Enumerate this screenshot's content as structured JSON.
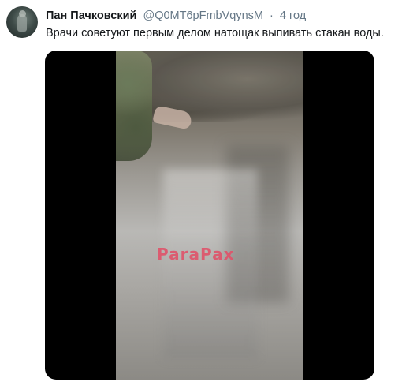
{
  "tweet": {
    "author_name": "Пан Пачковский",
    "author_handle": "@Q0MT6pFmbVqynsM",
    "separator": "·",
    "timestamp": "4 год",
    "text": "Врачи советуют первым делом натощак выпивать стакан воды."
  },
  "media": {
    "watermark": "ParaPax"
  },
  "colors": {
    "name": "#14171a",
    "secondary": "#657786",
    "watermark": "#e0536a"
  }
}
